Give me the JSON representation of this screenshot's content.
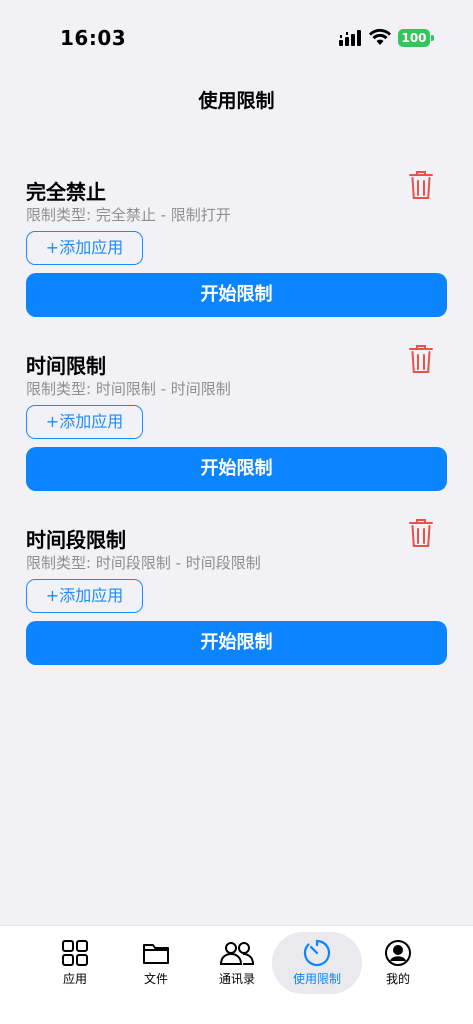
{
  "status_bar": {
    "time": "16:03",
    "battery": "100"
  },
  "nav": {
    "title": "使用限制"
  },
  "restrictions": [
    {
      "title": "完全禁止",
      "subtitle": "限制类型: 完全禁止 - 限制打开",
      "add_label": "+添加应用",
      "start_label": "开始限制"
    },
    {
      "title": "时间限制",
      "subtitle": "限制类型: 时间限制 - 时间限制",
      "add_label": "+添加应用",
      "start_label": "开始限制"
    },
    {
      "title": "时间段限制",
      "subtitle": "限制类型: 时间段限制 - 时间段限制",
      "add_label": "+添加应用",
      "start_label": "开始限制"
    }
  ],
  "tabs": [
    {
      "label": "应用",
      "icon": "apps-grid-icon"
    },
    {
      "label": "文件",
      "icon": "folder-icon"
    },
    {
      "label": "通讯录",
      "icon": "contacts-icon"
    },
    {
      "label": "使用限制",
      "icon": "timer-icon",
      "active": true
    },
    {
      "label": "我的",
      "icon": "profile-icon"
    }
  ],
  "colors": {
    "accent": "#0a84ff",
    "danger": "#e5534b",
    "background": "#f2f1f6",
    "battery": "#33c759"
  }
}
